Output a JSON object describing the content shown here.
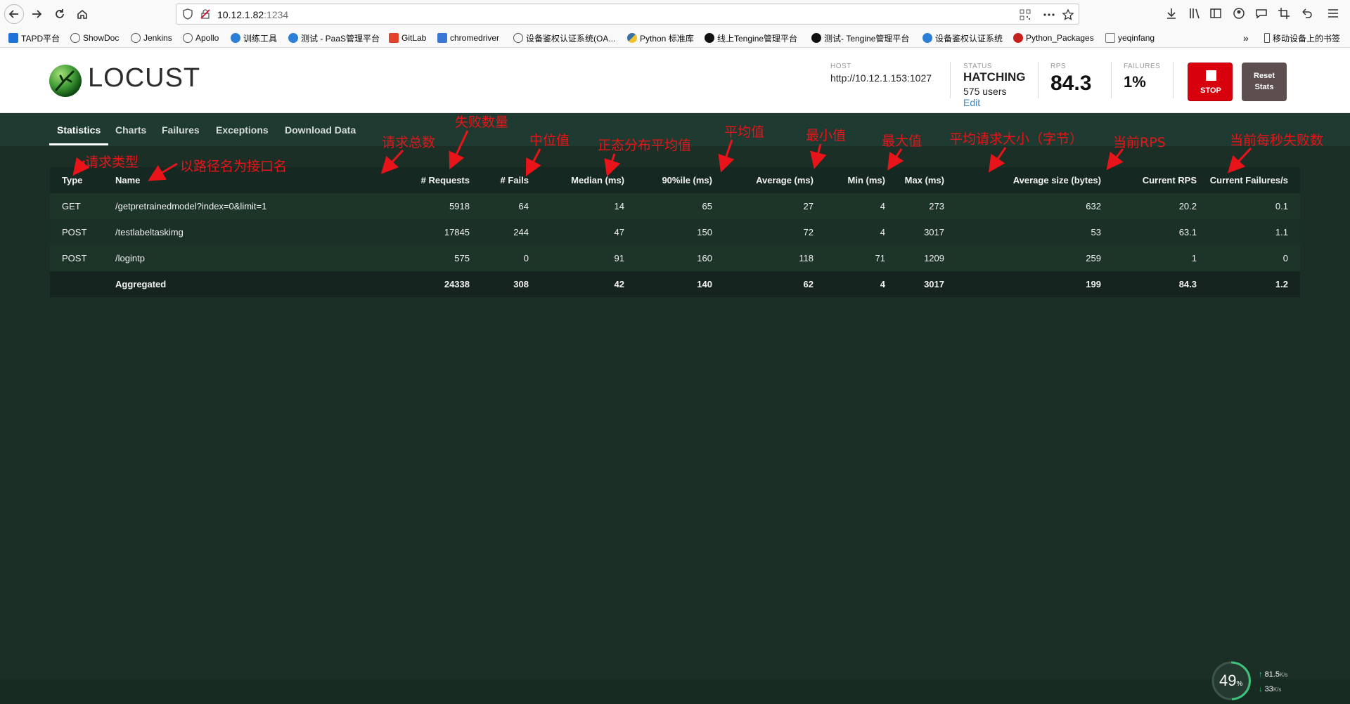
{
  "browser": {
    "url_host": "10.12.1.82",
    "url_port": ":1234",
    "bookmarks": [
      {
        "label": "TAPD平台",
        "color": "#1e73d9"
      },
      {
        "label": "ShowDoc",
        "color": "#555555"
      },
      {
        "label": "Jenkins",
        "color": "#555555"
      },
      {
        "label": "Apollo",
        "color": "#555555"
      },
      {
        "label": "训练工具",
        "color": "#2b7fd6"
      },
      {
        "label": "测试 - PaaS管理平台",
        "color": "#2b7fd6"
      },
      {
        "label": "GitLab",
        "color": "#e2432a"
      },
      {
        "label": "chromedriver",
        "color": "#3b78d6"
      },
      {
        "label": "设备鉴权认证系统(OA...",
        "color": "#555555"
      },
      {
        "label": "Python 标准库",
        "color": "#f2c12e"
      },
      {
        "label": "线上Tengine管理平台",
        "color": "#111111"
      },
      {
        "label": "测试- Tengine管理平台",
        "color": "#111111"
      },
      {
        "label": "设备鉴权认证系统",
        "color": "#2b7fd6"
      },
      {
        "label": "Python_Packages",
        "color": "#c8201e"
      },
      {
        "label": "yeqinfang",
        "color": "#777777"
      }
    ],
    "mobile_bookmarks": "移动设备上的书签"
  },
  "header": {
    "logo_text": "LOCUST",
    "host_label": "HOST",
    "host_value": "http://10.12.1.153:1027",
    "status_label": "STATUS",
    "status_value": "HATCHING",
    "users_value": "575 users",
    "edit_label": "Edit",
    "rps_label": "RPS",
    "rps_value": "84.3",
    "failures_label": "FAILURES",
    "failures_value": "1%",
    "stop_label": "STOP",
    "reset_label_1": "Reset",
    "reset_label_2": "Stats"
  },
  "tabs": [
    "Statistics",
    "Charts",
    "Failures",
    "Exceptions",
    "Download Data"
  ],
  "table": {
    "headers": [
      "Type",
      "Name",
      "# Requests",
      "# Fails",
      "Median (ms)",
      "90%ile (ms)",
      "Average (ms)",
      "Min (ms)",
      "Max (ms)",
      "Average size (bytes)",
      "Current RPS",
      "Current Failures/s"
    ],
    "rows": [
      [
        "GET",
        "/getpretrainedmodel?index=0&limit=1",
        "5918",
        "64",
        "14",
        "65",
        "27",
        "4",
        "273",
        "632",
        "20.2",
        "0.1"
      ],
      [
        "POST",
        "/testlabeltaskimg",
        "17845",
        "244",
        "47",
        "150",
        "72",
        "4",
        "3017",
        "53",
        "63.1",
        "1.1"
      ],
      [
        "POST",
        "/logintp",
        "575",
        "0",
        "91",
        "160",
        "118",
        "71",
        "1209",
        "259",
        "1",
        "0"
      ]
    ],
    "aggregated": [
      "",
      "Aggregated",
      "24338",
      "308",
      "42",
      "140",
      "62",
      "4",
      "3017",
      "199",
      "84.3",
      "1.2"
    ]
  },
  "annotations": {
    "type": "请求类型",
    "name": "以路径名为接口名",
    "requests": "请求总数",
    "fails": "失败数量",
    "median": "中位值",
    "p90": "正态分布平均值",
    "average": "平均值",
    "min": "最小值",
    "max": "最大值",
    "avg_size": "平均请求大小（字节）",
    "current_rps": "当前RPS",
    "current_fail": "当前每秒失败数"
  },
  "net_widget": {
    "percent": "49",
    "percent_unit": "%",
    "up": "81.5",
    "up_unit": "K/s",
    "down": "33",
    "down_unit": "K/s"
  },
  "colors": {
    "annotation": "#e8141a",
    "stop": "#d8000c",
    "table_bg": "#1b2f26"
  }
}
